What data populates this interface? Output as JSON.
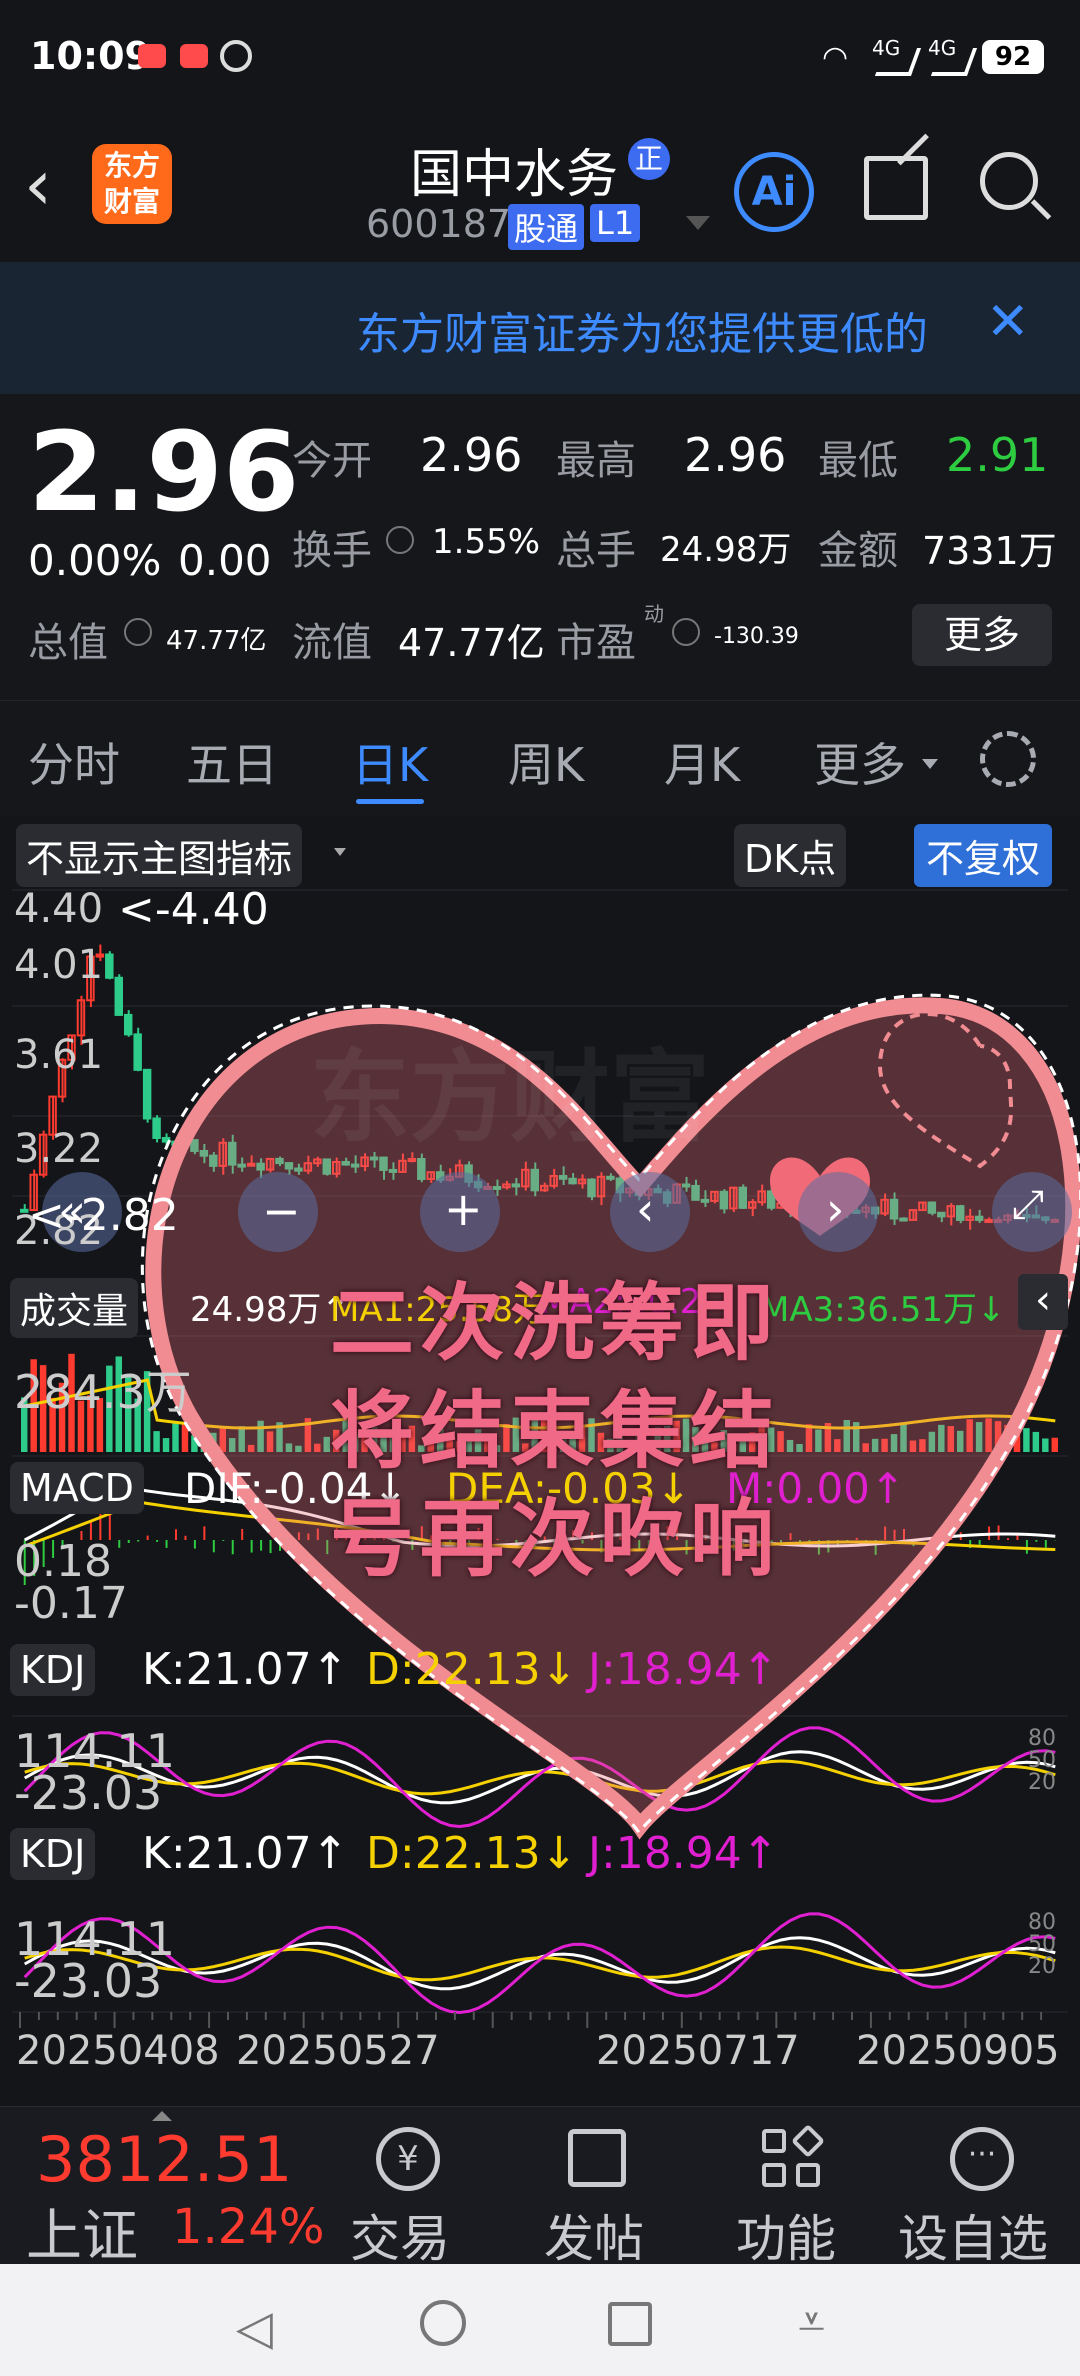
{
  "status_bar": {
    "time": "10:09",
    "net1": "4G",
    "net2": "4G",
    "battery": "92"
  },
  "header": {
    "logo_line1": "东方",
    "logo_line2": "财富",
    "stock_name": "国中水务",
    "badge": "正",
    "code": "600187",
    "tag1": "股通",
    "tag2": "L1",
    "ai": "Ai"
  },
  "banner": {
    "text": "东方财富证券为您提供更低的"
  },
  "quote": {
    "price": "2.96",
    "change_pct": "0.00%",
    "change": "0.00",
    "open_label": "今开",
    "open": "2.96",
    "high_label": "最高",
    "high": "2.96",
    "low_label": "最低",
    "low": "2.91",
    "turnover_label": "换手",
    "turnover": "1.55%",
    "volume_label": "总手",
    "volume": "24.98万",
    "amount_label": "金额",
    "amount": "7331万",
    "mcap_label": "总值",
    "mcap": "47.77亿",
    "float_label": "流值",
    "float": "47.77亿",
    "pe_label": "市盈",
    "pe_sup": "动",
    "pe": "-130.39",
    "more": "更多"
  },
  "tabs": [
    "分时",
    "五日",
    "日K",
    "周K",
    "月K",
    "更多"
  ],
  "chart": {
    "main_indicator": "不显示主图指标",
    "dk": "DK点",
    "fq": "不复权",
    "y_ticks": [
      "4.40",
      "4.01",
      "3.61",
      "3.22",
      "2.82"
    ],
    "max_label": "<-4.40",
    "min_label": "<-2.82",
    "vol_label": "成交量",
    "vol_value": "24.98万↑",
    "ma1": "MA1:25.58万↑",
    "ma2": "MA2:30.2",
    "ma3": "MA3:36.51万↓",
    "vol_tick": "284.3万",
    "macd_label": "MACD",
    "dif": "DIF:-0.04↓",
    "dea": "DEA:-0.03↓",
    "m": "M:0.00↑",
    "macd_ticks": [
      "0.18",
      "-0.17"
    ],
    "kdj_label": "KDJ",
    "k": "K:21.07↑",
    "d": "D:22.13↓",
    "j": "J:18.94↑",
    "kdj_ticks": [
      "114.11",
      "-23.03"
    ],
    "kdj_lvls": [
      "80",
      "50",
      "20"
    ],
    "dates": [
      "20250408",
      "20250527",
      "20250717",
      "20250905"
    ],
    "overlay_watermark": "东方财富",
    "overlay_text": [
      "二次洗筹即",
      "将结束集结",
      "号再次吹响"
    ]
  },
  "bottom_nav": {
    "index_value": "3812.51",
    "index_name": "上证",
    "index_change": "1.24%",
    "items": [
      "交易",
      "发帖",
      "功能",
      "设自选"
    ]
  },
  "colors": {
    "up": "#ff3b30",
    "down": "#2ecc40",
    "accent": "#3d8bff",
    "yellow": "#f5d100",
    "magenta": "#e020d0"
  }
}
